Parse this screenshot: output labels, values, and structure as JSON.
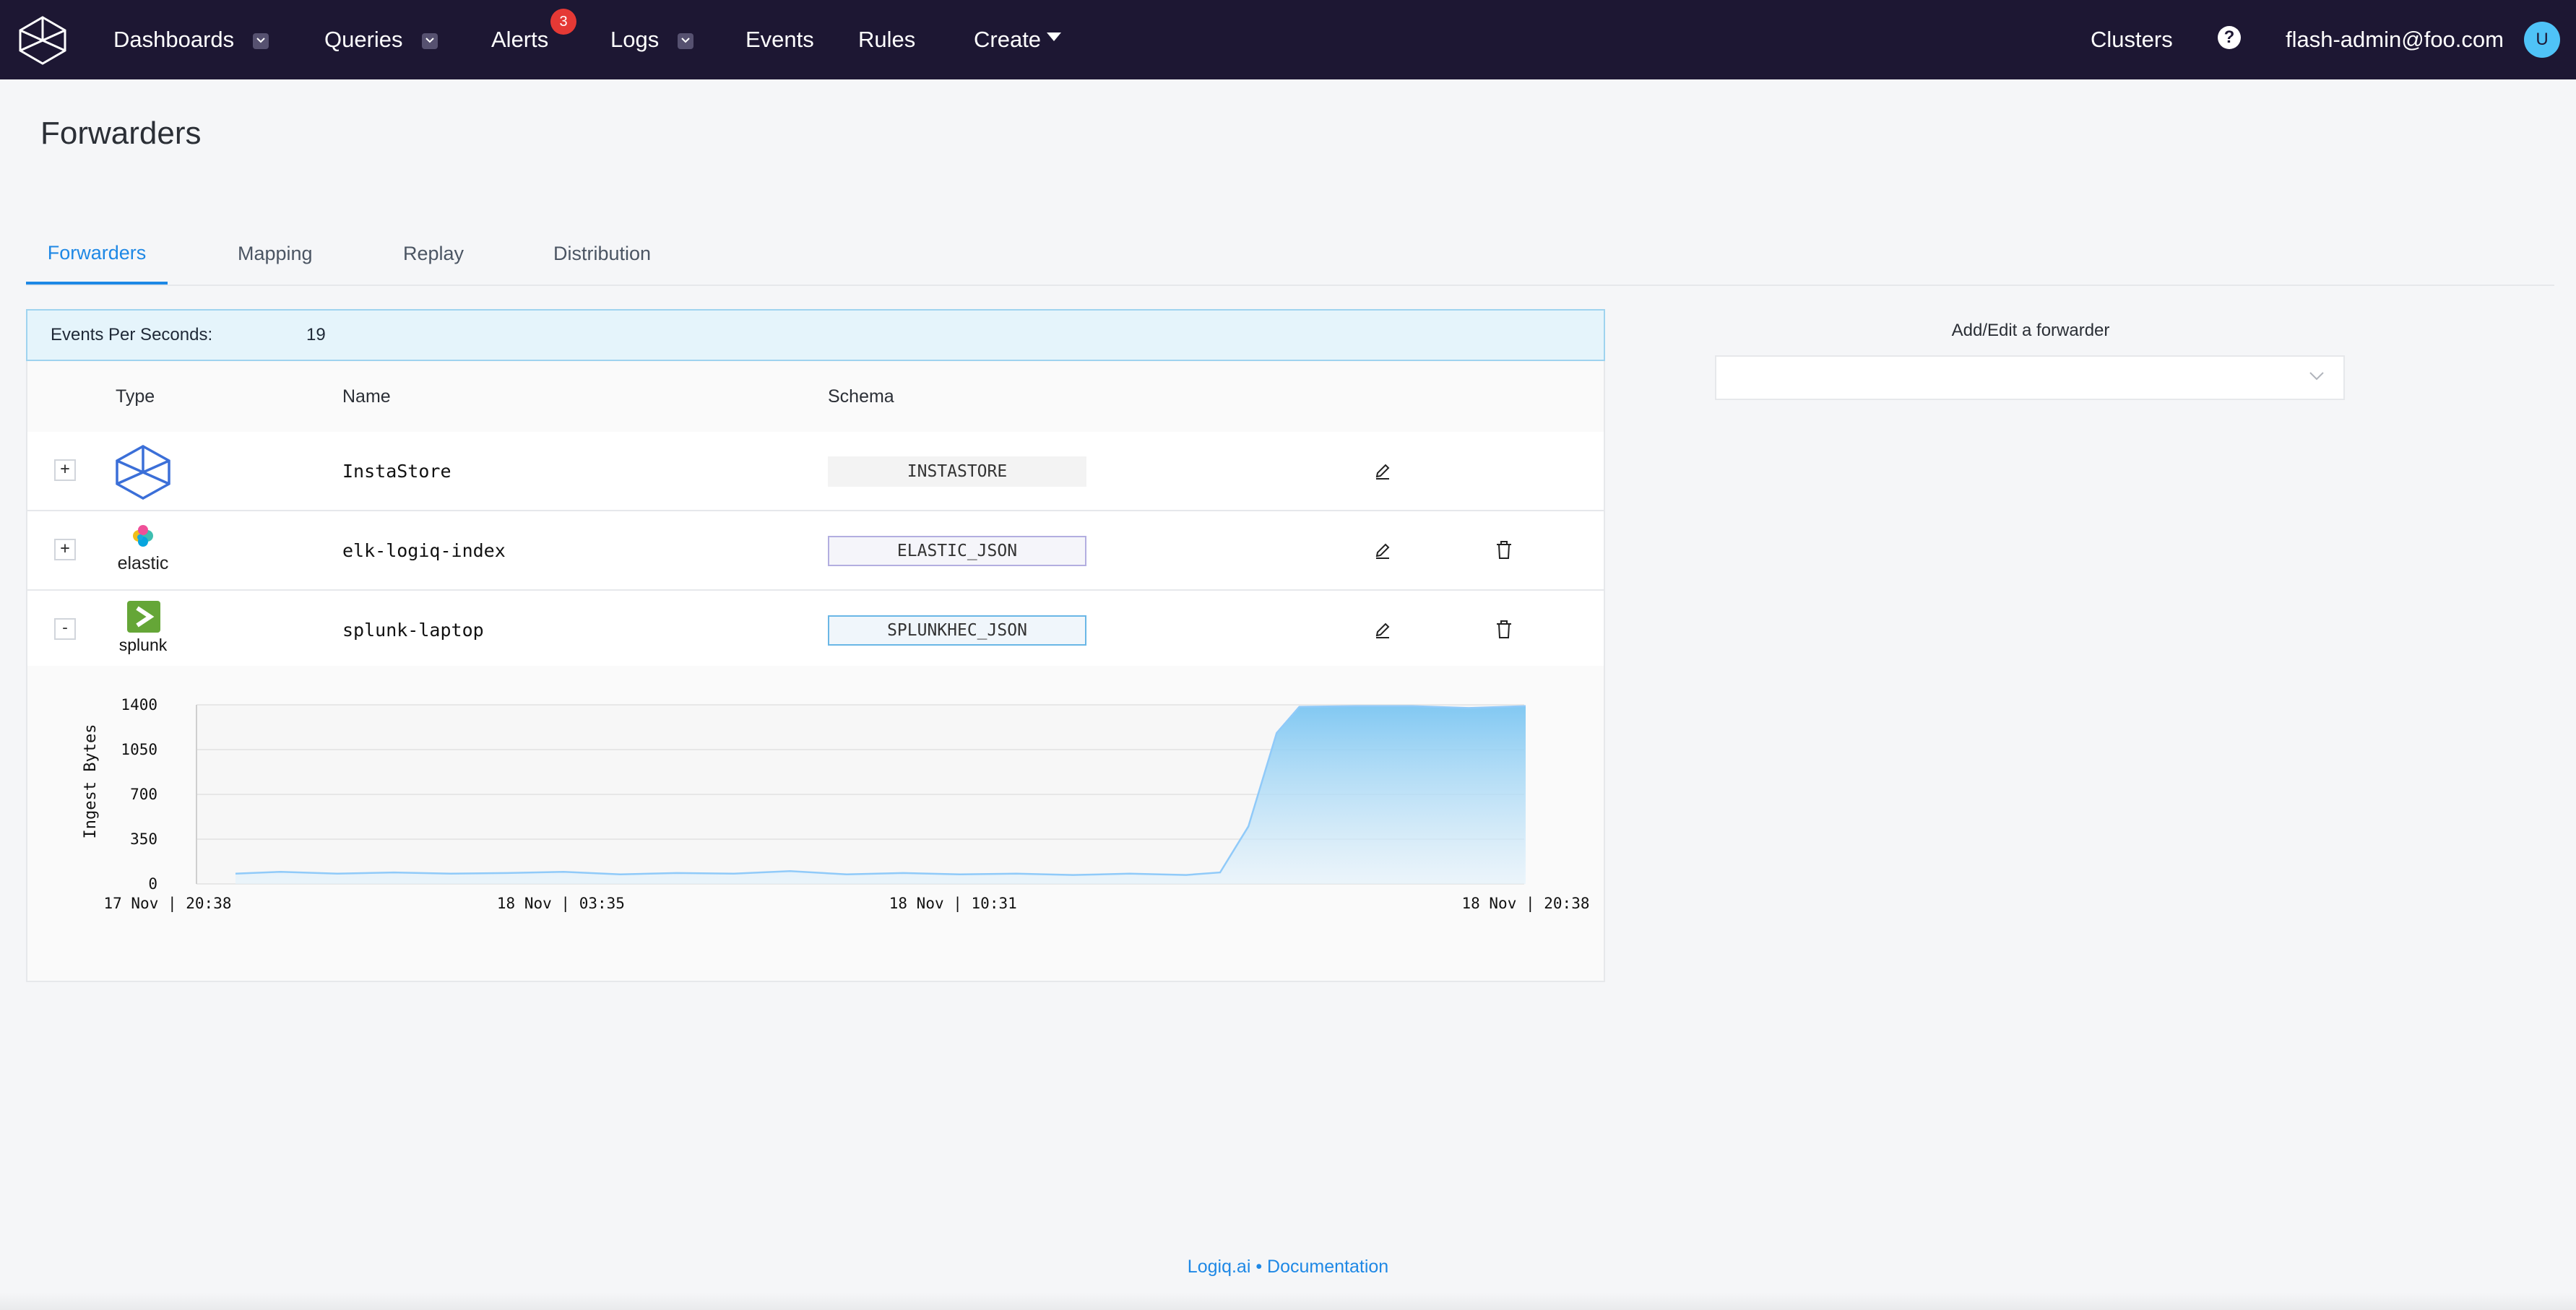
{
  "nav": {
    "items": [
      {
        "label": "Dashboards",
        "dropdown": true
      },
      {
        "label": "Queries",
        "dropdown": true
      },
      {
        "label": "Alerts",
        "badge": "3"
      },
      {
        "label": "Logs",
        "dropdown": true
      },
      {
        "label": "Events"
      },
      {
        "label": "Rules"
      },
      {
        "label": "Create"
      }
    ],
    "clusters": "Clusters",
    "help_glyph": "?",
    "user_email": "flash-admin@foo.com",
    "avatar_initial": "U"
  },
  "page": {
    "title": "Forwarders"
  },
  "tabs": [
    {
      "label": "Forwarders",
      "active": true
    },
    {
      "label": "Mapping"
    },
    {
      "label": "Replay"
    },
    {
      "label": "Distribution"
    }
  ],
  "stats": {
    "eps_label": "Events Per Seconds:",
    "eps_value": "19"
  },
  "table": {
    "headers": {
      "type": "Type",
      "name": "Name",
      "schema": "Schema"
    },
    "rows": [
      {
        "expander": "+",
        "type_icon": "instastore-logo",
        "name": "InstaStore",
        "schema": "INSTASTORE",
        "deletable": false
      },
      {
        "expander": "+",
        "type_icon": "elastic-logo",
        "type_label": "elastic",
        "name": "elk-logiq-index",
        "schema": "ELASTIC_JSON",
        "deletable": true
      },
      {
        "expander": "-",
        "type_icon": "splunk-logo",
        "type_label": "splunk",
        "name": "splunk-laptop",
        "schema": "SPLUNKHEC_JSON",
        "deletable": true
      }
    ]
  },
  "chart_data": {
    "type": "area",
    "ylabel": "Ingest Bytes",
    "ylim": [
      0,
      1400
    ],
    "y_ticks": [
      0,
      350,
      700,
      1050,
      1400
    ],
    "x_range": [
      0,
      24
    ],
    "x_tick_labels": [
      {
        "t": 0,
        "label": "17 Nov | 20:38"
      },
      {
        "t": 6.95,
        "label": "18 Nov | 03:35"
      },
      {
        "t": 13.88,
        "label": "18 Nov | 10:31"
      },
      {
        "t": 24,
        "label": "18 Nov | 20:38"
      }
    ],
    "series": [
      {
        "color": "#90caf9",
        "x": [
          1.2,
          2,
          3,
          4,
          5,
          6,
          7,
          8,
          9,
          10,
          11,
          12,
          13,
          14,
          15,
          16,
          17,
          18,
          18.6,
          19.1,
          19.6,
          20,
          21,
          22,
          23,
          24
        ],
        "y": [
          80,
          95,
          80,
          90,
          80,
          85,
          95,
          75,
          85,
          80,
          100,
          75,
          85,
          75,
          80,
          70,
          80,
          70,
          90,
          450,
          1180,
          1385,
          1390,
          1390,
          1375,
          1390
        ]
      }
    ]
  },
  "right_panel": {
    "label": "Add/Edit a forwarder",
    "select_value": ""
  },
  "footer": {
    "link1": "Logiq.ai",
    "separator": "•",
    "link2": "Documentation"
  }
}
